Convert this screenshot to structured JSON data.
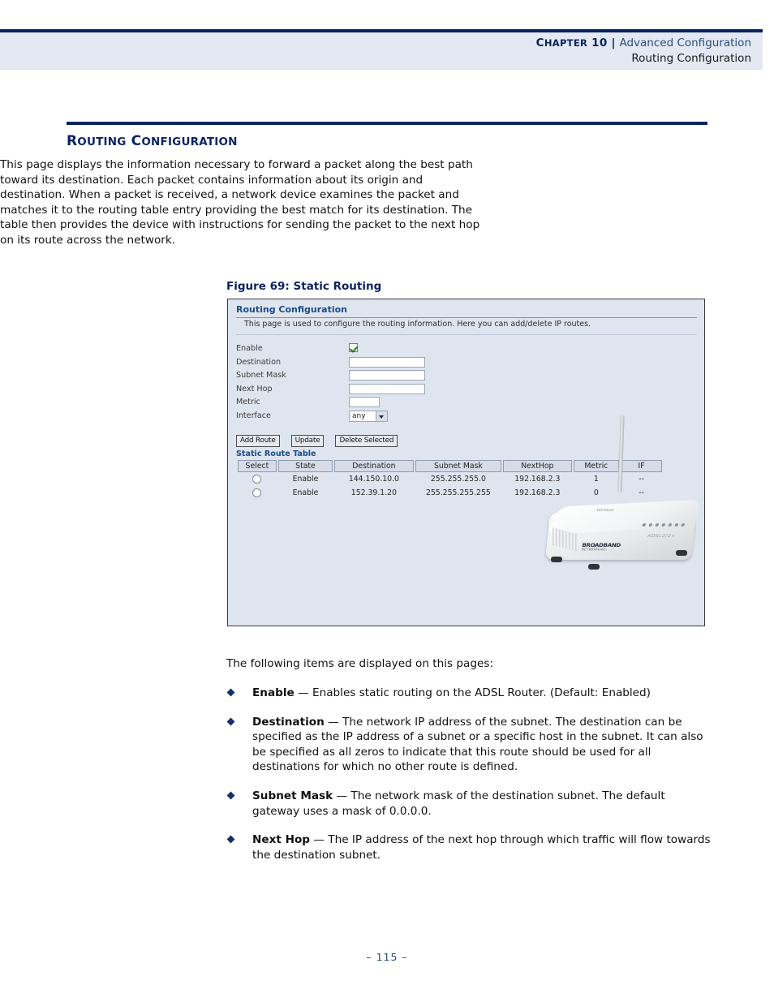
{
  "header": {
    "chapter_label": "Chapter 10",
    "chapter_label_first": "C",
    "chapter_label_rest": "HAPTER",
    "chapter_number": "10",
    "separator": "|",
    "chapter_title": "Advanced Configuration",
    "section_title": "Routing Configuration"
  },
  "section": {
    "heading_parts": {
      "w1_first": "R",
      "w1_rest": "OUTING",
      "w2_first": "C",
      "w2_rest": "ONFIGURATION"
    },
    "heading_plain": "Routing Configuration",
    "intro_paragraph": "This page displays the information necessary to forward a packet along the best path toward its destination. Each packet contains information about its origin and destination. When a packet is received, a network device examines the packet and matches it to the routing table entry providing the best match for its destination. The table then provides the device with instructions for sending the packet to the next hop on its route across the network."
  },
  "figure": {
    "caption": "Figure 69:  Static Routing",
    "panel_title": "Routing Configuration",
    "panel_subtitle": "This page is used to configure the routing information. Here you can add/delete IP routes.",
    "form": {
      "enable_label": "Enable",
      "enable_checked": true,
      "destination_label": "Destination",
      "destination_value": "",
      "subnet_mask_label": "Subnet Mask",
      "subnet_mask_value": "",
      "next_hop_label": "Next Hop",
      "next_hop_value": "",
      "metric_label": "Metric",
      "metric_value": "",
      "interface_label": "Interface",
      "interface_value": "any"
    },
    "buttons": {
      "add_route": "Add Route",
      "update": "Update",
      "delete_selected": "Delete Selected"
    },
    "table": {
      "title": "Static Route Table",
      "columns": [
        "Select",
        "State",
        "Destination",
        "Subnet Mask",
        "NextHop",
        "Metric",
        "IF"
      ],
      "rows": [
        {
          "select": "",
          "state": "Enable",
          "destination": "144.150.10.0",
          "subnet_mask": "255.255.255.0",
          "next_hop": "192.168.2.3",
          "metric": "1",
          "if": "--"
        },
        {
          "select": "",
          "state": "Enable",
          "destination": "152.39.1.20",
          "subnet_mask": "255.255.255.255",
          "next_hop": "192.168.2.3",
          "metric": "0",
          "if": "--"
        }
      ]
    },
    "device": {
      "brand": "BROADBAND",
      "brand_sub": "NETWORKING",
      "model": "ADSL2/2+",
      "top_mark": "Wireless"
    }
  },
  "body": {
    "following_line": "The following items are displayed on this pages:",
    "bullets": [
      {
        "term": "Enable",
        "dash": " — ",
        "text": "Enables static routing on the ADSL Router. (Default: Enabled)"
      },
      {
        "term": "Destination",
        "dash": " — ",
        "text": "The network IP address of the subnet. The destination can be specified as the IP address of a subnet or a specific host in the subnet. It can also be specified as all zeros to indicate that this route should be used for all destinations for which no other route is defined."
      },
      {
        "term": "Subnet Mask",
        "dash": " — ",
        "text": "The network mask of the destination subnet. The default gateway uses a mask of 0.0.0.0."
      },
      {
        "term": "Next Hop",
        "dash": " — ",
        "text": "The IP address of the next hop through which traffic will flow towards the destination subnet."
      }
    ]
  },
  "footer": {
    "page_number": "–  115  –"
  },
  "colors": {
    "navy": "#0b2461",
    "header_band": "#e3e8f2",
    "link_blue": "#2a4a80",
    "figure_bg": "#dfe5ee",
    "bullet": "#16306b"
  }
}
